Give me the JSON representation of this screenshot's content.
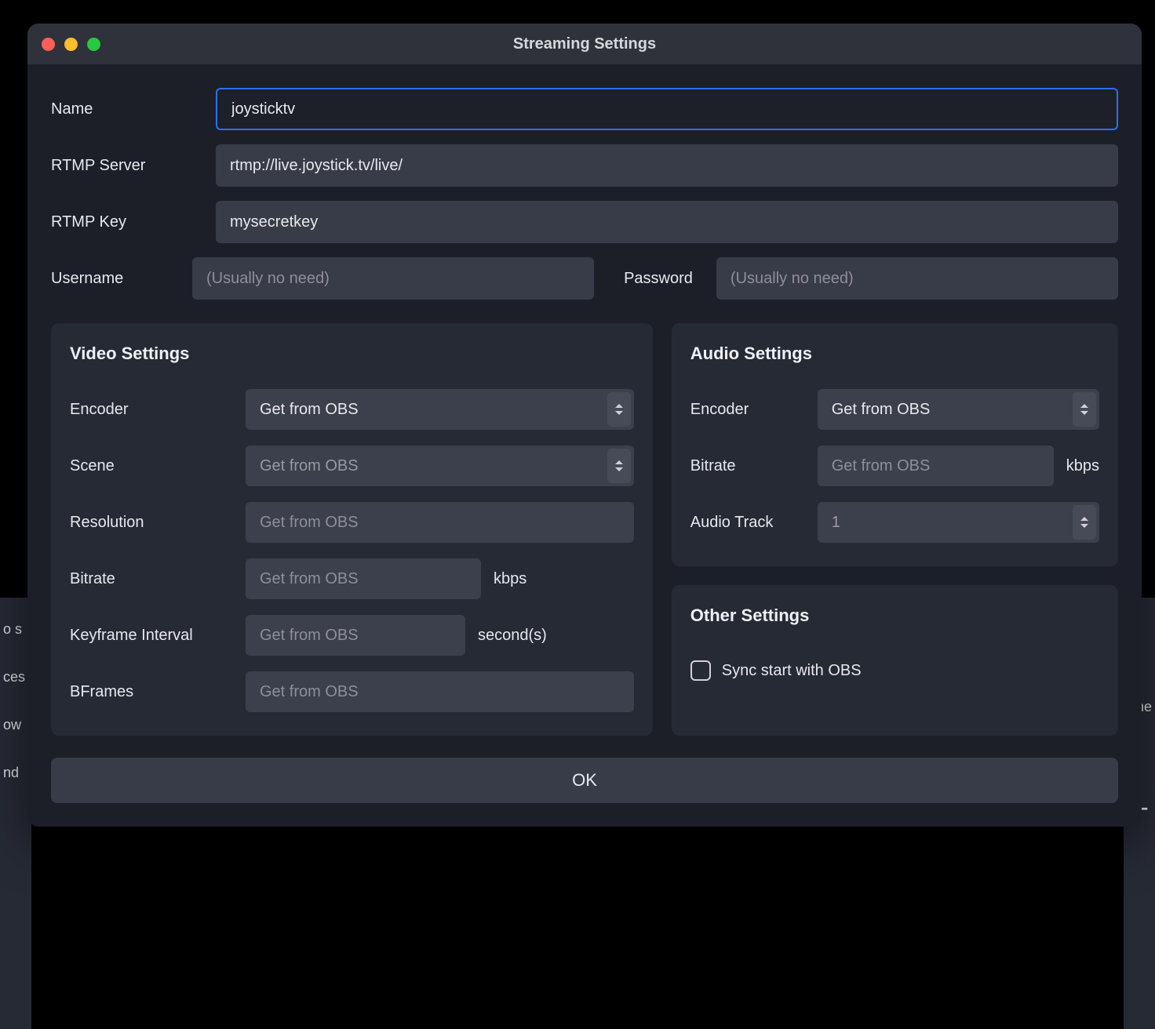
{
  "window": {
    "title": "Streaming Settings"
  },
  "fields": {
    "name_label": "Name",
    "name_value": "joysticktv",
    "rtmp_server_label": "RTMP Server",
    "rtmp_server_value": "rtmp://live.joystick.tv/live/",
    "rtmp_key_label": "RTMP Key",
    "rtmp_key_value": "mysecretkey",
    "username_label": "Username",
    "username_placeholder": "(Usually no need)",
    "password_label": "Password",
    "password_placeholder": "(Usually no need)"
  },
  "video": {
    "title": "Video Settings",
    "encoder_label": "Encoder",
    "encoder_value": "Get from OBS",
    "scene_label": "Scene",
    "scene_value": "Get from OBS",
    "resolution_label": "Resolution",
    "resolution_placeholder": "Get from OBS",
    "bitrate_label": "Bitrate",
    "bitrate_placeholder": "Get from OBS",
    "bitrate_unit": "kbps",
    "keyframe_label": "Keyframe Interval",
    "keyframe_placeholder": "Get from OBS",
    "keyframe_unit": "second(s)",
    "bframes_label": "BFrames",
    "bframes_placeholder": "Get from OBS"
  },
  "audio": {
    "title": "Audio Settings",
    "encoder_label": "Encoder",
    "encoder_value": "Get from OBS",
    "bitrate_label": "Bitrate",
    "bitrate_placeholder": "Get from OBS",
    "bitrate_unit": "kbps",
    "track_label": "Audio Track",
    "track_value": "1"
  },
  "other": {
    "title": "Other Settings",
    "sync_label": "Sync start with OBS"
  },
  "buttons": {
    "ok": "OK"
  },
  "background": {
    "left_items": [
      "o s",
      "ces",
      "ow",
      "nd"
    ],
    "right_items": [
      "ne"
    ]
  }
}
